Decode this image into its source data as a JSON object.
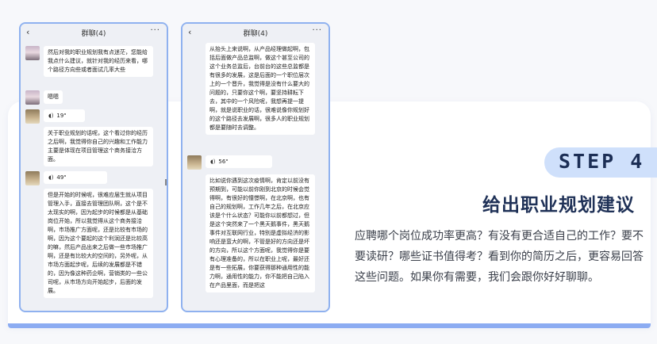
{
  "phone_left": {
    "title": "群聊(4)",
    "messages": [
      {
        "type": "text",
        "avatar": "a1",
        "text": "然后对我的职业规划我有点迷茫，您能给我点什么建议，就针对我的经历来看，哪个路径方向些或者面试几率大些"
      },
      {
        "type": "text",
        "avatar": "a1",
        "text": "嗯嗯"
      },
      {
        "type": "voice",
        "avatar": "a2",
        "duration": "19\""
      },
      {
        "type": "text",
        "avatar": "a2",
        "text": "关于职业规划的话呢，这个看过你的经历之后啊，我觉得你自己的兴趣和工作能力主要是体现在项目管理这个商务接洽方面。"
      },
      {
        "type": "voice",
        "avatar": "a2",
        "duration": "49\""
      },
      {
        "type": "text",
        "avatar": "a2",
        "text": "但是开始的时候呢，很难应届生就从项目管理入手，直接去管理团队啊，这个是不太现实的啊，因为起步的时候都是从基础岗位开始，所以我觉得从这个商务接洽啊，市场推广方面呢，还是比较有市场的啊，因为这个要起的这个利润还是比较高的嘛，然后产品出来之后做一些市场推广啊，还是有比较大的空间的，另外呢，从市场方面起步呢，后续的发展都是不错的，因为像这种药企啊，营销类的一些公司呢，从市场方向开始起步，后面的发展。"
      }
    ]
  },
  "phone_right": {
    "title": "群聊(4)",
    "messages": [
      {
        "type": "text",
        "avatar": "a2",
        "text": "从抬头上来说啊，从产品经理做起啊，包括后面做产品总监啊，做这个甚至公司的这个业务总监后，台前台的这些总监都是有很多的发展，这是后面的一个职位层次上的一个晋升，我觉得是没有什么要大的问题的，只要你这个啊，要坚持耕耘下去，其中的一个风险呢，我想再提一提啊，就是说职业的话，很难说像你规划好的这个路径去发展啊，很多人的职业规划都是要随时去调整。"
      },
      {
        "type": "voice",
        "avatar": "a2",
        "duration": "56\""
      },
      {
        "type": "text",
        "avatar": "a2",
        "text": "比如说你遇到这次疫情啊，肯定以前没有预期到，可能以前你刚到北京的时候会觉得啊，有很好的憧憬啊，在北京啊，也有自己的规划啊，工作几年之后，在北京应该是个什么状态？可能你以前都想过，但是这个突然来了一个黑天鹅事件，黑天鹅事件对互联网行业，特别是虚拟经济的影响还是蛮大的啊，不管是好的方向还是坏的方向，所以这个方面呢，我觉得你是要有心理准备的，所以在职业上呢，最好还是有一些拓展，你要获得那种通用性的能力啊，通用性的能力，你不能把自己陷入在产品里面，而是把这"
      }
    ]
  },
  "step": {
    "label": "STEP 4",
    "heading": "给出职业规划建议",
    "description": "应聘哪个岗位成功率更高？有没有更合适自己的工作？要不要读研？哪些证书值得考？看到你的简历之后，更容易回答这些问题。如果你有需要，我们会跟你好好聊聊。"
  },
  "icons": {
    "back": "‹",
    "more": "···",
    "voice": "◖)"
  },
  "colors": {
    "accent": "#8fb1ef",
    "pill": "#cfe0fb",
    "heading": "#1f3157"
  }
}
